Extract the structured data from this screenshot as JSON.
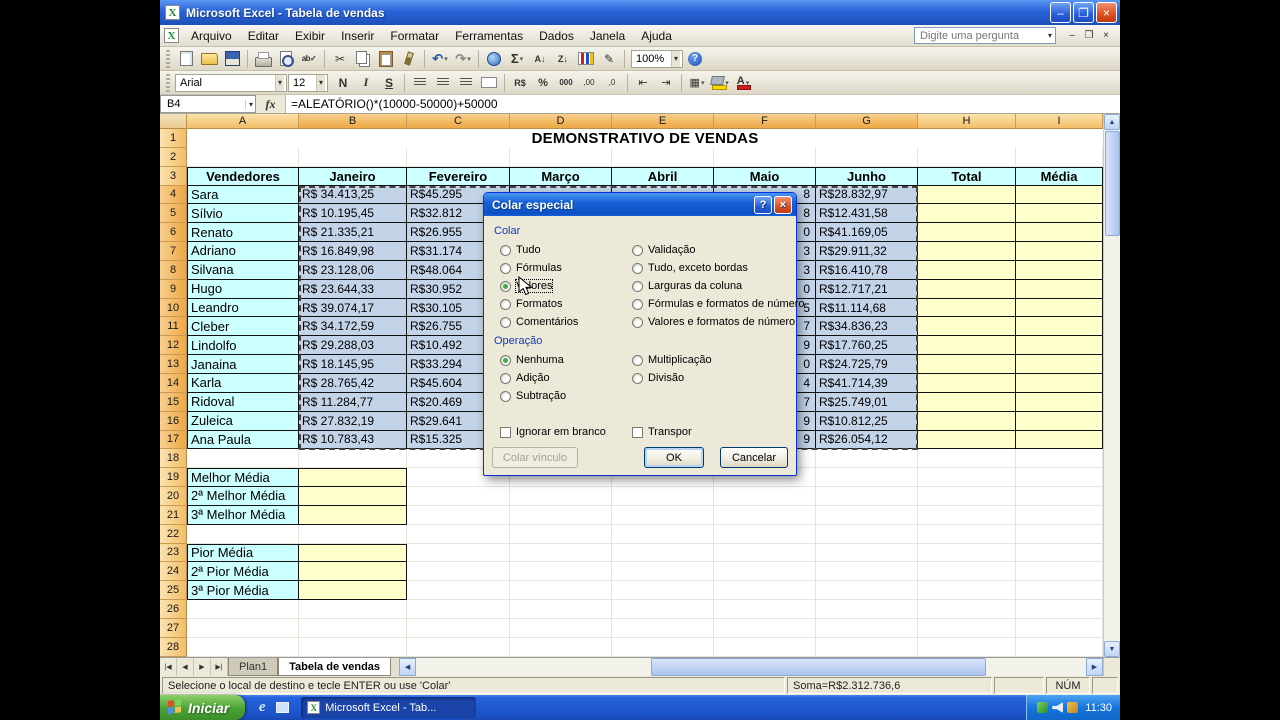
{
  "window": {
    "title": "Microsoft Excel - Tabela de vendas",
    "controls": {
      "minimize": "–",
      "maximize": "❐",
      "close": "×"
    }
  },
  "menubar": {
    "items": [
      "Arquivo",
      "Editar",
      "Exibir",
      "Inserir",
      "Formatar",
      "Ferramentas",
      "Dados",
      "Janela",
      "Ajuda"
    ],
    "question_placeholder": "Digite uma pergunta",
    "doc_controls": {
      "minimize": "–",
      "restore": "❐",
      "close": "×"
    }
  },
  "standard_toolbar": {
    "zoom_value": "100%",
    "icons": [
      {
        "name": "new-document-icon"
      },
      {
        "name": "open-folder-icon"
      },
      {
        "name": "save-icon"
      },
      {
        "name": "separator"
      },
      {
        "name": "print-icon"
      },
      {
        "name": "print-preview-icon"
      },
      {
        "name": "spelling-icon",
        "glyph": "ab✓"
      },
      {
        "name": "separator"
      },
      {
        "name": "cut-icon",
        "glyph": "✂"
      },
      {
        "name": "copy-icon"
      },
      {
        "name": "paste-icon"
      },
      {
        "name": "format-painter-icon"
      },
      {
        "name": "separator"
      },
      {
        "name": "undo-icon",
        "glyph": "↶",
        "caret": true
      },
      {
        "name": "redo-icon",
        "glyph": "↷",
        "caret": true
      },
      {
        "name": "separator"
      },
      {
        "name": "hyperlink-icon"
      },
      {
        "name": "autosum-icon",
        "glyph": "Σ",
        "caret": true
      },
      {
        "name": "sort-ascending-icon",
        "glyph": "A↓"
      },
      {
        "name": "sort-descending-icon",
        "glyph": "Z↓"
      },
      {
        "name": "chart-wizard-icon"
      },
      {
        "name": "drawing-icon",
        "glyph": "✎"
      },
      {
        "name": "separator"
      }
    ]
  },
  "formatting_toolbar": {
    "font_name": "Arial",
    "font_size": "12",
    "icons": [
      {
        "name": "bold-icon",
        "glyph": "N"
      },
      {
        "name": "italic-icon",
        "glyph": "I"
      },
      {
        "name": "underline-icon",
        "glyph": "S"
      },
      {
        "name": "separator"
      },
      {
        "name": "align-left-icon"
      },
      {
        "name": "align-center-icon"
      },
      {
        "name": "align-right-icon"
      },
      {
        "name": "merge-center-icon"
      },
      {
        "name": "separator"
      },
      {
        "name": "currency-style-icon",
        "glyph": "R$"
      },
      {
        "name": "percent-style-icon",
        "glyph": "%"
      },
      {
        "name": "comma-style-icon",
        "glyph": "000"
      },
      {
        "name": "increase-decimal-icon",
        "glyph": ",00"
      },
      {
        "name": "decrease-decimal-icon",
        "glyph": ",0"
      },
      {
        "name": "separator"
      },
      {
        "name": "decrease-indent-icon",
        "glyph": "⇤"
      },
      {
        "name": "increase-indent-icon",
        "glyph": "⇥"
      },
      {
        "name": "separator"
      },
      {
        "name": "borders-icon",
        "glyph": "▦",
        "caret": true
      },
      {
        "name": "fill-color-icon",
        "caret": true
      },
      {
        "name": "font-color-icon",
        "glyph": "A",
        "caret": true
      }
    ]
  },
  "formula_bar": {
    "name_box": "B4",
    "fx": "fx",
    "formula": "=ALEATÓRIO()*(10000-50000)+50000"
  },
  "sheet": {
    "title": "DEMONSTRATIVO DE VENDAS",
    "columns": [
      "A",
      "B",
      "C",
      "D",
      "E",
      "F",
      "G",
      "H",
      "I"
    ],
    "headers": [
      "Vendedores",
      "Janeiro",
      "Fevereiro",
      "Março",
      "Abril",
      "Maio",
      "Junho",
      "Total",
      "Média"
    ],
    "visible_rows": 28,
    "vendors": [
      {
        "name": "Sara",
        "janeiro": "R$ 34.413,25",
        "fevereiro": "R$45.295",
        "maio_tail": "8",
        "junho": "R$28.832,97"
      },
      {
        "name": "Sílvio",
        "janeiro": "R$ 10.195,45",
        "fevereiro": "R$32.812",
        "maio_tail": "8",
        "junho": "R$12.431,58"
      },
      {
        "name": "Renato",
        "janeiro": "R$ 21.335,21",
        "fevereiro": "R$26.955",
        "maio_tail": "0",
        "junho": "R$41.169,05"
      },
      {
        "name": "Adriano",
        "janeiro": "R$ 16.849,98",
        "fevereiro": "R$31.174",
        "maio_tail": "3",
        "junho": "R$29.911,32"
      },
      {
        "name": "Silvana",
        "janeiro": "R$ 23.128,06",
        "fevereiro": "R$48.064",
        "maio_tail": "3",
        "junho": "R$16.410,78"
      },
      {
        "name": "Hugo",
        "janeiro": "R$ 23.644,33",
        "fevereiro": "R$30.952",
        "maio_tail": "0",
        "junho": "R$12.717,21"
      },
      {
        "name": "Leandro",
        "janeiro": "R$ 39.074,17",
        "fevereiro": "R$30.105",
        "maio_tail": "5",
        "junho": "R$11.114,68"
      },
      {
        "name": "Cleber",
        "janeiro": "R$ 34.172,59",
        "fevereiro": "R$26.755",
        "maio_tail": "7",
        "junho": "R$34.836,23"
      },
      {
        "name": "Lindolfo",
        "janeiro": "R$ 29.288,03",
        "fevereiro": "R$10.492",
        "maio_tail": "9",
        "junho": "R$17.760,25"
      },
      {
        "name": "Janaina",
        "janeiro": "R$ 18.145,95",
        "fevereiro": "R$33.294",
        "maio_tail": "0",
        "junho": "R$24.725,79"
      },
      {
        "name": "Karla",
        "janeiro": "R$ 28.765,42",
        "fevereiro": "R$45.604",
        "maio_tail": "4",
        "junho": "R$41.714,39"
      },
      {
        "name": "Ridoval",
        "janeiro": "R$ 11.284,77",
        "fevereiro": "R$20.469",
        "maio_tail": "7",
        "junho": "R$25.749,01"
      },
      {
        "name": "Zuleica",
        "janeiro": "R$ 27.832,19",
        "fevereiro": "R$29.641",
        "maio_tail": "9",
        "junho": "R$10.812,25"
      },
      {
        "name": "Ana Paula",
        "janeiro": "R$ 10.783,43",
        "fevereiro": "R$15.325",
        "maio_tail": "9",
        "junho": "R$26.054,12"
      }
    ],
    "best_rows": [
      "Melhor Média",
      "2ª Melhor Média",
      "3ª Melhor Média"
    ],
    "worst_rows": [
      "Pior Média",
      "2ª Pior Média",
      "3ª Pior Média"
    ]
  },
  "dialog": {
    "title": "Colar especial",
    "help_glyph": "?",
    "close_glyph": "×",
    "colar_label": "Colar",
    "colar_left": [
      {
        "label": "Tudo",
        "selected": false
      },
      {
        "label": "Fórmulas",
        "selected": false
      },
      {
        "label": "Valores",
        "selected": true,
        "focus": true
      },
      {
        "label": "Formatos",
        "selected": false
      },
      {
        "label": "Comentários",
        "selected": false
      }
    ],
    "colar_right": [
      {
        "label": "Validação",
        "selected": false
      },
      {
        "label": "Tudo, exceto bordas",
        "selected": false
      },
      {
        "label": "Larguras da coluna",
        "selected": false
      },
      {
        "label": "Fórmulas e formatos de número",
        "selected": false
      },
      {
        "label": "Valores e formatos de número",
        "selected": false
      }
    ],
    "operacao_label": "Operação",
    "operacao_left": [
      {
        "label": "Nenhuma",
        "selected": true
      },
      {
        "label": "Adição",
        "selected": false
      },
      {
        "label": "Subtração",
        "selected": false
      }
    ],
    "operacao_right": [
      {
        "label": "Multiplicação",
        "selected": false
      },
      {
        "label": "Divisão",
        "selected": false
      }
    ],
    "checkboxes": [
      {
        "label": "Ignorar em branco",
        "checked": false
      },
      {
        "label": "Transpor",
        "checked": false
      }
    ],
    "buttons": {
      "paste_link": "Colar vínculo",
      "ok": "OK",
      "cancel": "Cancelar"
    }
  },
  "tab_strip": {
    "nav": [
      "|◀",
      "◀",
      "▶",
      "▶|"
    ],
    "tabs": [
      {
        "label": "Plan1",
        "active": false
      },
      {
        "label": "Tabela de vendas",
        "active": true
      }
    ]
  },
  "scrollbar": {
    "up": "▲",
    "down": "▼",
    "left": "◀",
    "right": "▶"
  },
  "status_bar": {
    "message": "Selecione o local de destino e tecle ENTER ou use 'Colar'",
    "sum": "Soma=R$2.312.736,6",
    "num_lock": "NÚM"
  },
  "taskbar": {
    "start": "Iniciar",
    "task": "Microsoft Excel - Tab...",
    "time": "11:30",
    "quick_launch": [
      {
        "name": "internet-explorer-icon",
        "glyph": "e"
      },
      {
        "name": "show-desktop-icon"
      }
    ],
    "tray_icons": [
      {
        "name": "security-shield-icon"
      },
      {
        "name": "volume-icon"
      },
      {
        "name": "update-icon"
      }
    ]
  }
}
